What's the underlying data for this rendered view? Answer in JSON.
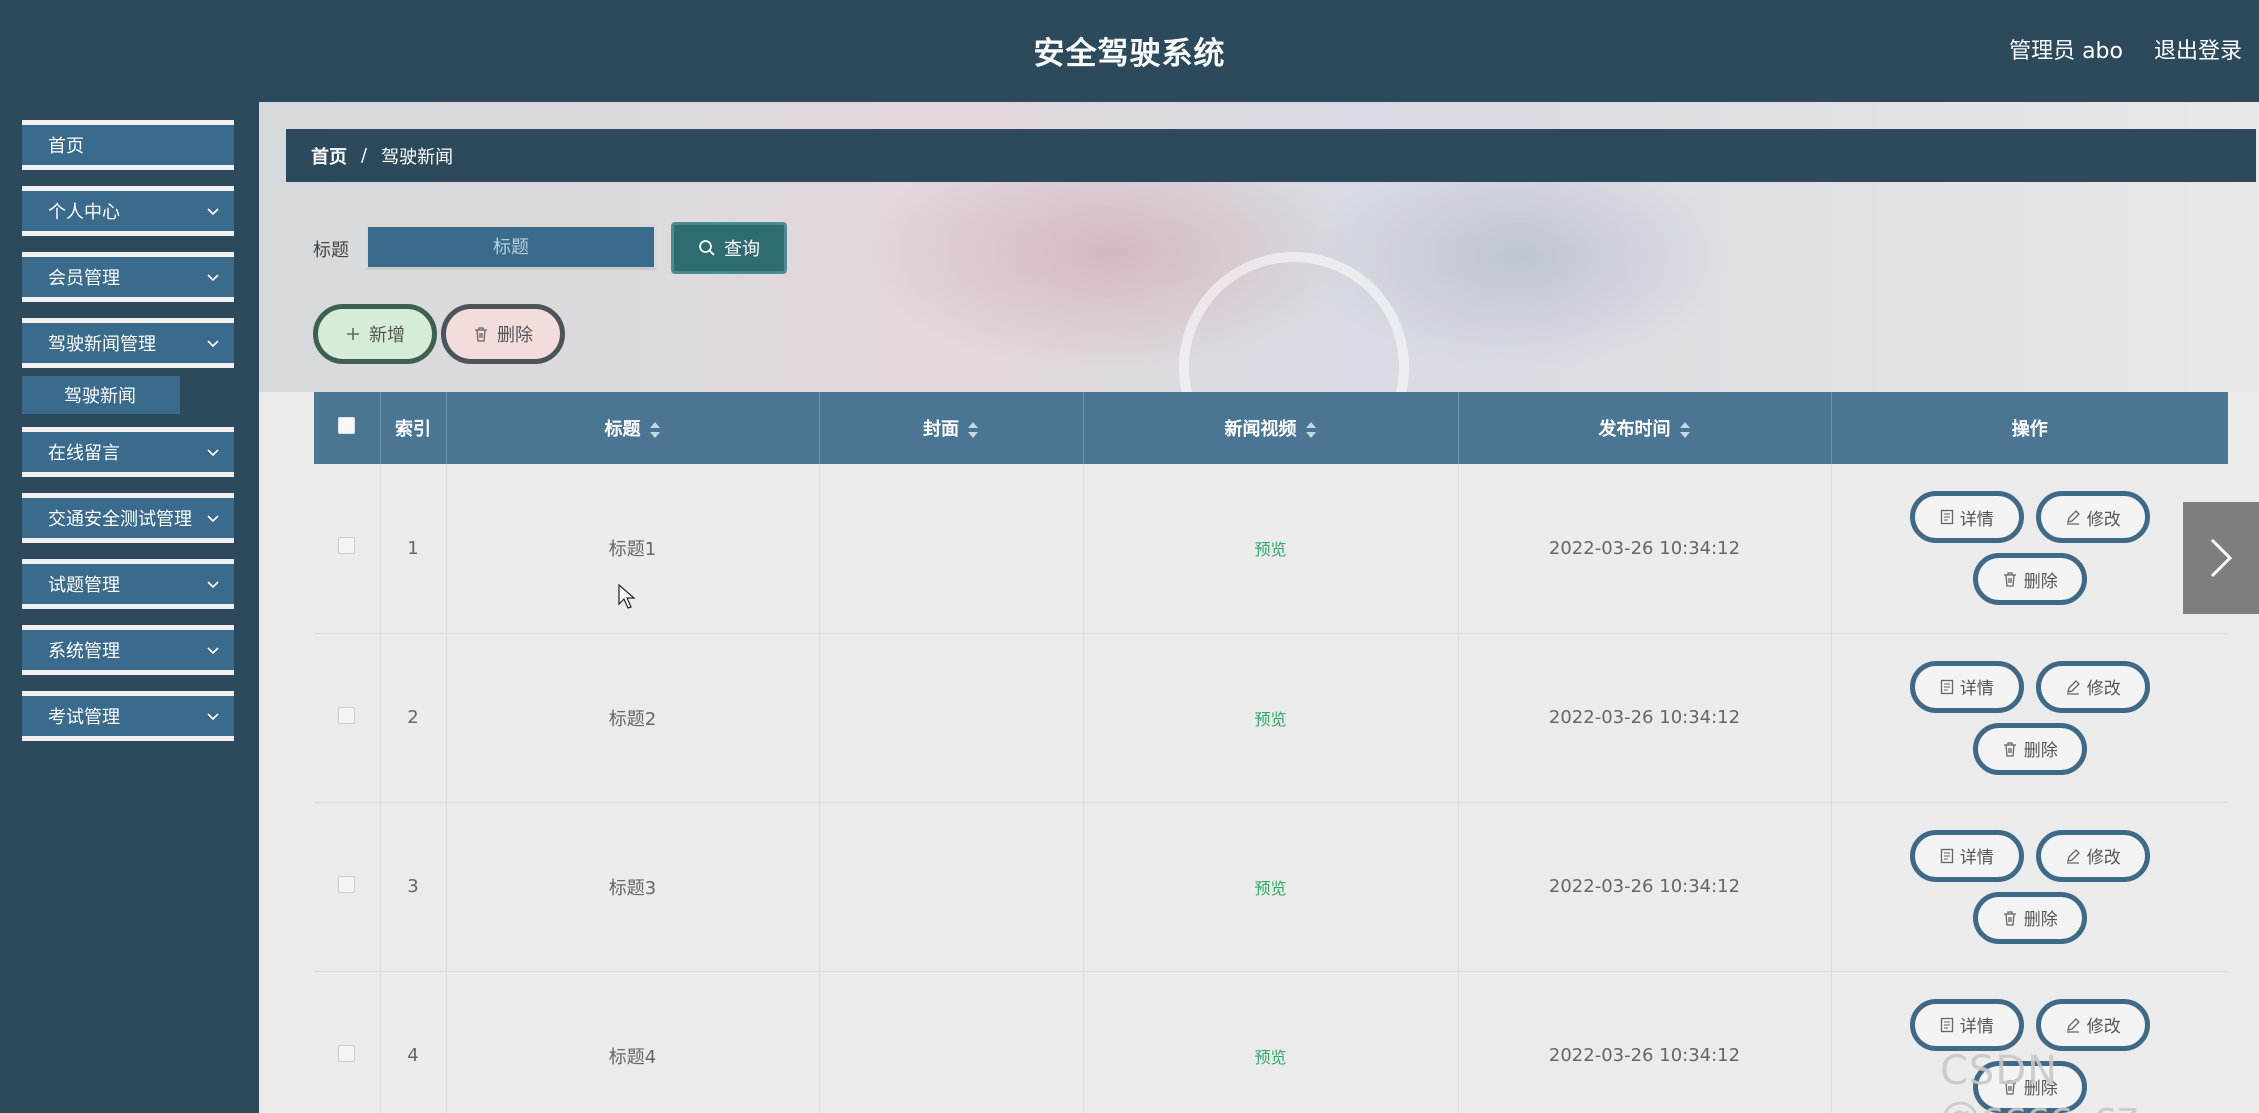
{
  "header": {
    "title": "安全驾驶系统",
    "user": "管理员 abo",
    "logout": "退出登录"
  },
  "sidebar": {
    "items": [
      {
        "label": "首页"
      },
      {
        "label": "个人中心"
      },
      {
        "label": "会员管理"
      },
      {
        "label": "驾驶新闻管理"
      },
      {
        "label": "在线留言"
      },
      {
        "label": "交通安全测试管理"
      },
      {
        "label": "试题管理"
      },
      {
        "label": "系统管理"
      },
      {
        "label": "考试管理"
      }
    ],
    "subitem": "驾驶新闻"
  },
  "breadcrumb": {
    "home": "首页",
    "separator": "/",
    "current": "驾驶新闻"
  },
  "search": {
    "label": "标题",
    "placeholder": "标题",
    "button": "查询"
  },
  "actions": {
    "add": "新增",
    "delete": "删除"
  },
  "table": {
    "columns": [
      "索引",
      "标题",
      "封面",
      "新闻视频",
      "发布时间",
      "操作"
    ],
    "rows": [
      {
        "index": "1",
        "title": "标题1",
        "cover": "",
        "video": "预览",
        "time": "2022-03-26 10:34:12"
      },
      {
        "index": "2",
        "title": "标题2",
        "cover": "",
        "video": "预览",
        "time": "2022-03-26 10:34:12"
      },
      {
        "index": "3",
        "title": "标题3",
        "cover": "",
        "video": "预览",
        "time": "2022-03-26 10:34:12"
      },
      {
        "index": "4",
        "title": "标题4",
        "cover": "",
        "video": "预览",
        "time": "2022-03-26 10:34:12"
      }
    ],
    "row_actions": {
      "detail": "详情",
      "edit": "修改",
      "delete": "删除"
    }
  },
  "watermark": "CSDN @cccc_cz",
  "colors": {
    "header_bg": "#2c4a5c",
    "menu_bg": "#3a6a8c",
    "table_head": "#4a7694",
    "preview_link": "#2fa86a"
  }
}
